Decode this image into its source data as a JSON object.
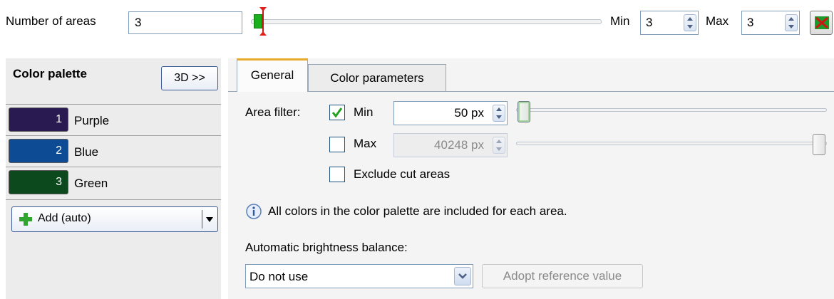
{
  "top": {
    "areas_label": "Number of areas",
    "areas_value": "3",
    "min_label": "Min",
    "min_value": "3",
    "max_label": "Max",
    "max_value": "3"
  },
  "palette": {
    "title": "Color palette",
    "button_3d": "3D >>",
    "items": [
      {
        "num": "1",
        "name": "Purple",
        "color": "#2a1a52"
      },
      {
        "num": "2",
        "name": "Blue",
        "color": "#0d4b94"
      },
      {
        "num": "3",
        "name": "Green",
        "color": "#0c4a1e"
      }
    ],
    "add_label": "Add (auto)"
  },
  "tabs": {
    "general": "General",
    "color_parameters": "Color parameters"
  },
  "general": {
    "area_filter_label": "Area filter:",
    "min_label": "Min",
    "min_checked": true,
    "min_value": "50 px",
    "max_label": "Max",
    "max_checked": false,
    "max_value": "40248 px",
    "exclude_label": "Exclude cut areas",
    "exclude_checked": false,
    "info_text": "All colors in the color palette are included for each area.",
    "brightness_label": "Automatic brightness balance:",
    "brightness_value": "Do not use",
    "adopt_button": "Adopt reference value"
  }
}
